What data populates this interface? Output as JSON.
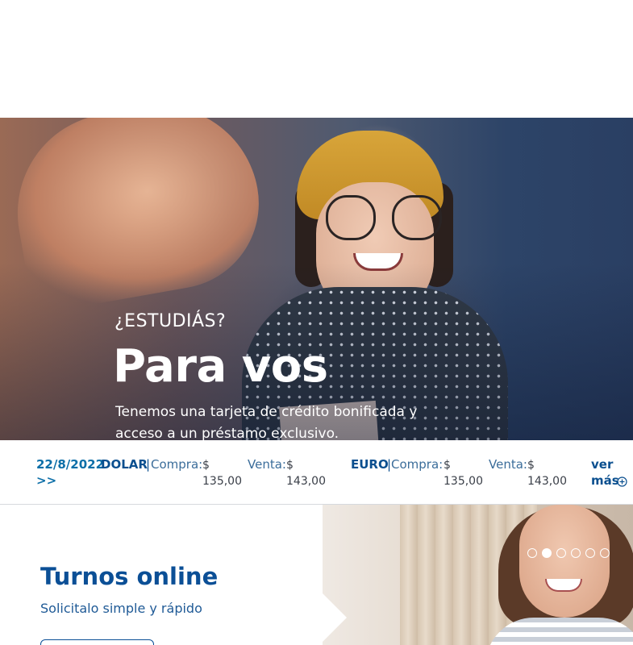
{
  "hero": {
    "kicker": "¿ESTUDIÁS?",
    "title": "Para vos",
    "text": "Tenemos una tarjeta de crédito bonificada y acceso a un préstamo exclusivo."
  },
  "rates": {
    "date": "22/8/2022",
    "date_more": ">>",
    "dolar": {
      "label": "DOLAR",
      "separator": "|",
      "compra_label": "Compra:",
      "compra_value": "$ 135,00",
      "venta_label": "Venta:",
      "venta_value": "$ 143,00"
    },
    "euro": {
      "label": "EURO",
      "separator": "|",
      "compra_label": "Compra:",
      "compra_value": "$ 135,00",
      "venta_label": "Venta:",
      "venta_value": "$ 143,00"
    },
    "ver": "ver",
    "mas": "más",
    "plus_icon": "plus-circle-icon"
  },
  "turnos": {
    "title": "Turnos online",
    "subtitle": "Solicitalo simple y rápido",
    "carousel": {
      "count": 6,
      "active_index": 1
    }
  },
  "colors": {
    "brand_dark": "#0b4f96",
    "brand_link": "#0d6fa8"
  }
}
